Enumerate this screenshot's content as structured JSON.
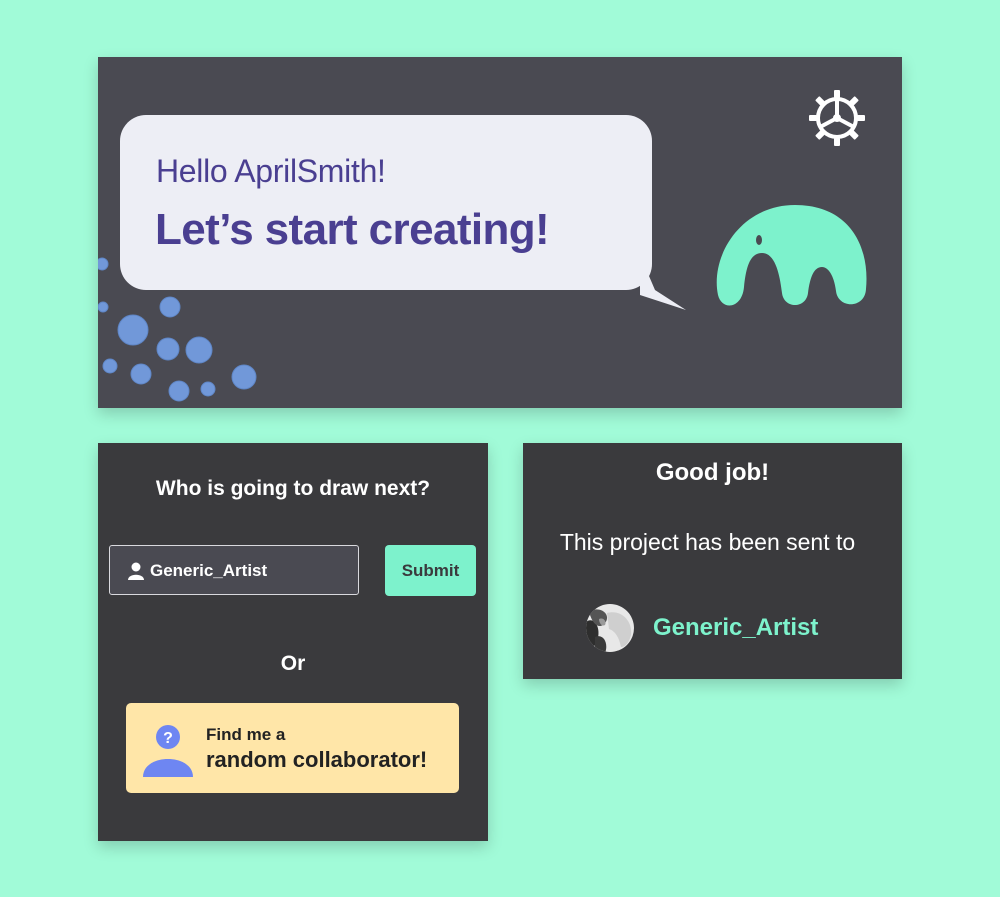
{
  "banner": {
    "greeting": "Hello AprilSmith!",
    "headline": "Let’s start creating!",
    "settings_icon": "gear-icon",
    "mascot_icon": "elephant-mascot-icon"
  },
  "collab": {
    "title": "Who is going to draw next?",
    "input_value": "Generic_Artist",
    "input_icon": "user-icon",
    "submit_label": "Submit",
    "or_label": "Or",
    "random_line1": "Find me a",
    "random_line2": "random collaborator!",
    "random_icon": "question-avatar-icon"
  },
  "sent": {
    "title": "Good job!",
    "message": "This project has been sent to",
    "recipient_name": "Generic_Artist",
    "recipient_avatar": "user-avatar"
  },
  "colors": {
    "background": "#a1fbd8",
    "banner": "#4a4a52",
    "card": "#3a3a3d",
    "accent": "#7df2cc",
    "bubble": "#edeef5",
    "text_purple": "#4a3f91",
    "random_button": "#ffe6a8",
    "avatar_blue": "#6e86f2",
    "dots_blue": "#7198d9"
  }
}
